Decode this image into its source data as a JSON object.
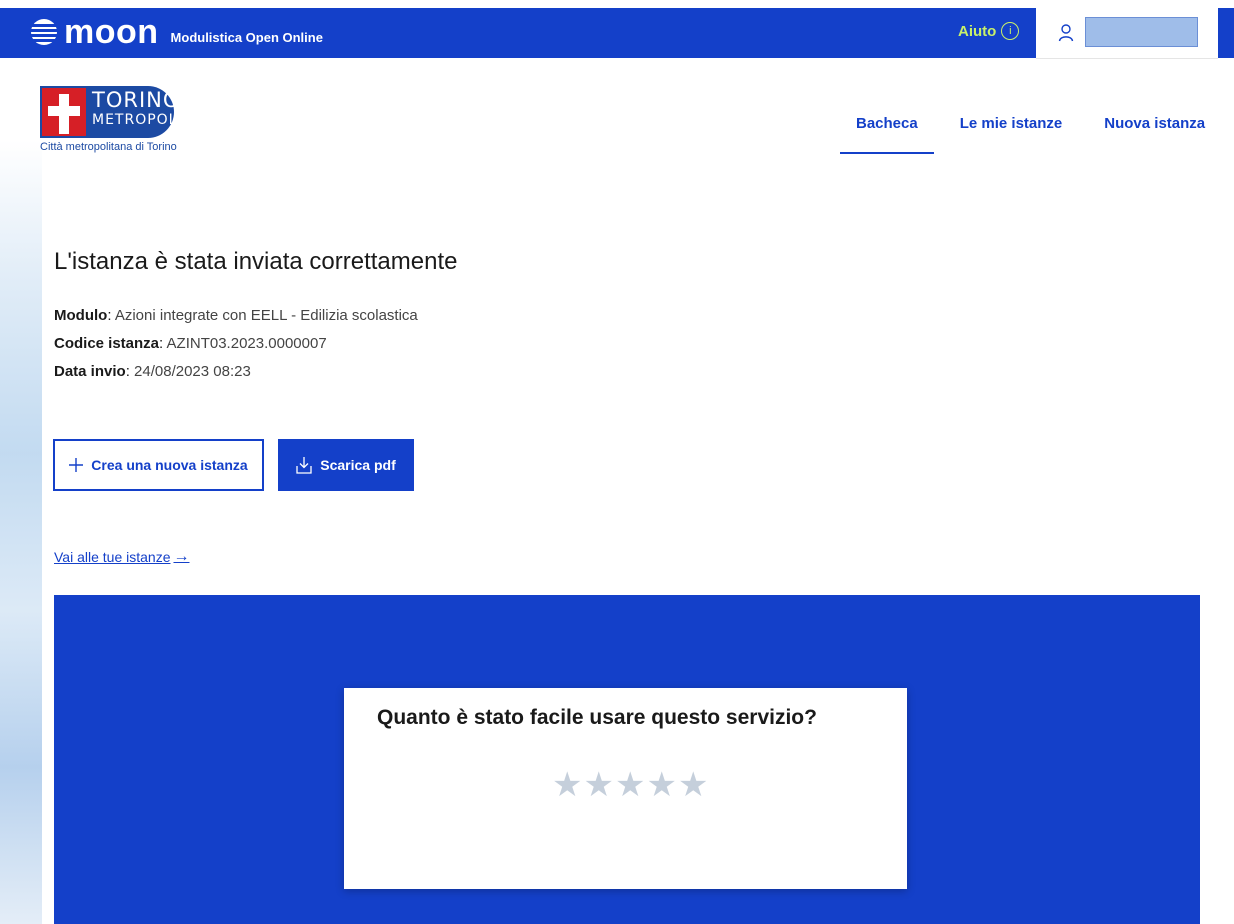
{
  "topbar": {
    "brand": "moon",
    "subtitle": "Modulistica Open Online",
    "help_label": "Aiuto",
    "help_icon": "info-circle-icon",
    "user_icon": "user-icon",
    "colors": {
      "bar": "#1440c9",
      "help": "#c8f06a"
    }
  },
  "header": {
    "logo_line1": "TORINO",
    "logo_line2": "METROPOLI",
    "logo_caption": "Città metropolitana di Torino",
    "nav": [
      {
        "label": "Bacheca",
        "active": true
      },
      {
        "label": "Le mie istanze",
        "active": false
      },
      {
        "label": "Nuova istanza",
        "active": false
      }
    ]
  },
  "main": {
    "title": "L'istanza è stata inviata correttamente",
    "details": {
      "module_label": "Modulo",
      "module_value": "Azioni integrate con EELL - Edilizia scolastica",
      "code_label": "Codice istanza",
      "code_value": "AZINT03.2023.0000007",
      "date_label": "Data invio",
      "date_value": "24/08/2023 08:23"
    },
    "buttons": {
      "new_request": "Crea una nuova istanza",
      "new_request_icon": "plus-icon",
      "download_pdf": "Scarica pdf",
      "download_icon": "download-icon"
    },
    "link_all": "Vai alle tue istanze",
    "link_icon": "arrow-right-icon"
  },
  "feedback": {
    "question": "Quanto è stato facile usare questo servizio?",
    "rating": 0,
    "rating_max": 5,
    "colors": {
      "band": "#1440c9",
      "star_inactive": "#c5cfdb"
    }
  }
}
